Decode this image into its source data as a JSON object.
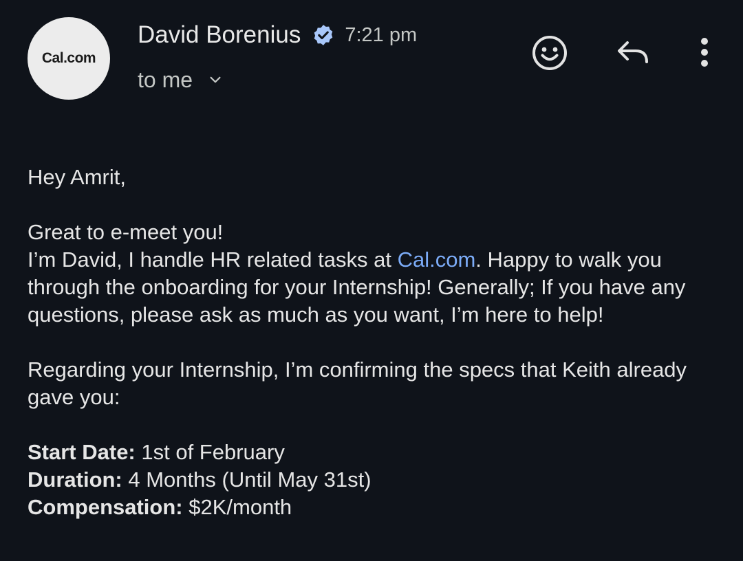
{
  "header": {
    "avatar_text": "Cal.com",
    "sender_name": "David Borenius",
    "time": "7:21 pm",
    "recipient": "to me"
  },
  "icons": {
    "verified": "verified-badge-icon",
    "emoji": "add-reaction-icon",
    "reply": "reply-icon",
    "more": "more-vertical-icon",
    "chevron": "chevron-down-icon"
  },
  "colors": {
    "background": "#0f131a",
    "link": "#7cacf8",
    "verified": "#a8c7fa"
  },
  "body": {
    "greeting": "Hey Amrit,",
    "p1_line1": "Great to e-meet you!",
    "p1_pre_link": "I’m David, I handle HR related tasks at ",
    "link_text": "Cal.com",
    "p1_post_link": ". Happy to walk you through the onboarding for your Internship! Generally; If you have any questions, please ask as much as you want, I’m here to help!",
    "p2": "Regarding your Internship, I’m confirming the specs that Keith already gave you:",
    "specs": [
      {
        "label": "Start Date:",
        "value": " 1st of February"
      },
      {
        "label": "Duration:",
        "value": " 4 Months (Until May 31st)"
      },
      {
        "label": "Compensation:",
        "value": " $2K/month"
      }
    ]
  }
}
